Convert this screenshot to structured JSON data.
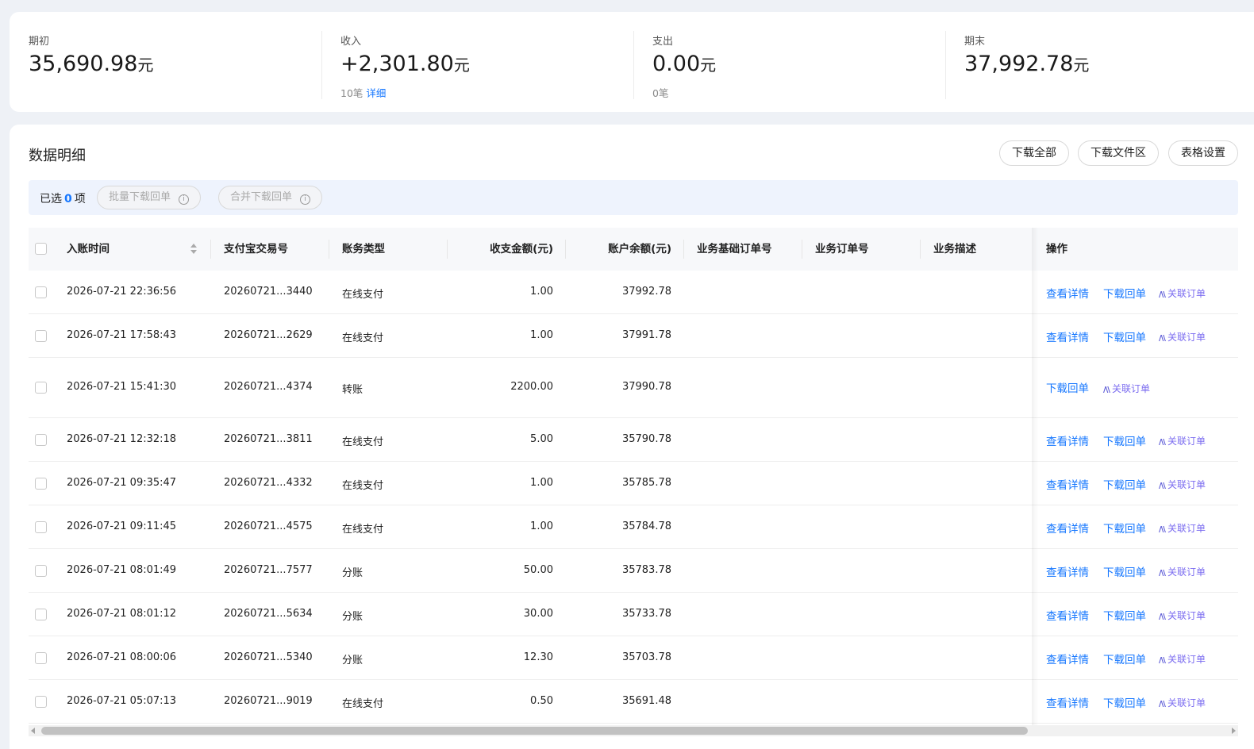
{
  "summary": [
    {
      "label": "期初",
      "value": "35,690.98",
      "unit": "元",
      "sub_count": "",
      "sub_link": ""
    },
    {
      "label": "收入",
      "value": "+2,301.80",
      "unit": "元",
      "sub_count": "10笔",
      "sub_link": "详细"
    },
    {
      "label": "支出",
      "value": "0.00",
      "unit": "元",
      "sub_count": "0笔",
      "sub_link": ""
    },
    {
      "label": "期末",
      "value": "37,992.78",
      "unit": "元",
      "sub_count": "",
      "sub_link": ""
    }
  ],
  "main": {
    "title": "数据明细",
    "buttons": {
      "download_all": "下载全部",
      "download_area": "下载文件区",
      "table_settings": "表格设置"
    }
  },
  "selection": {
    "prefix": "已选",
    "count": "0",
    "suffix": "项",
    "batch_download": "批量下载回单",
    "merge_download": "合并下载回单",
    "info_glyph": "i"
  },
  "table": {
    "headers": {
      "time": "入账时间",
      "trade_no": "支付宝交易号",
      "type": "账务类型",
      "amount": "收支金额(元)",
      "balance": "账户余额(元)",
      "base_order": "业务基础订单号",
      "order": "业务订单号",
      "desc": "业务描述",
      "ops": "操作"
    },
    "actions": {
      "detail": "查看详情",
      "receipt": "下载回单",
      "link_order": "关联订单",
      "ai_glyph": "/\\\\"
    },
    "rows": [
      {
        "time": "2026-07-21 22:36:56",
        "trade_no": "20260721...3440",
        "type": "在线支付",
        "amount": "1.00",
        "balance": "37992.78",
        "has_detail": true
      },
      {
        "time": "2026-07-21 17:58:43",
        "trade_no": "20260721...2629",
        "type": "在线支付",
        "amount": "1.00",
        "balance": "37991.78",
        "has_detail": true
      },
      {
        "time": "2026-07-21 15:41:30",
        "trade_no": "20260721...4374",
        "type": "转账",
        "amount": "2200.00",
        "balance": "37990.78",
        "has_detail": false
      },
      {
        "time": "2026-07-21 12:32:18",
        "trade_no": "20260721...3811",
        "type": "在线支付",
        "amount": "5.00",
        "balance": "35790.78",
        "has_detail": true
      },
      {
        "time": "2026-07-21 09:35:47",
        "trade_no": "20260721...4332",
        "type": "在线支付",
        "amount": "1.00",
        "balance": "35785.78",
        "has_detail": true
      },
      {
        "time": "2026-07-21 09:11:45",
        "trade_no": "20260721...4575",
        "type": "在线支付",
        "amount": "1.00",
        "balance": "35784.78",
        "has_detail": true
      },
      {
        "time": "2026-07-21 08:01:49",
        "trade_no": "20260721...7577",
        "type": "分账",
        "amount": "50.00",
        "balance": "35783.78",
        "has_detail": true
      },
      {
        "time": "2026-07-21 08:01:12",
        "trade_no": "20260721...5634",
        "type": "分账",
        "amount": "30.00",
        "balance": "35733.78",
        "has_detail": true
      },
      {
        "time": "2026-07-21 08:00:06",
        "trade_no": "20260721...5340",
        "type": "分账",
        "amount": "12.30",
        "balance": "35703.78",
        "has_detail": true
      },
      {
        "time": "2026-07-21 05:07:13",
        "trade_no": "20260721...9019",
        "type": "在线支付",
        "amount": "0.50",
        "balance": "35691.48",
        "has_detail": true
      }
    ]
  },
  "colors": {
    "accent": "#1677ff",
    "ai": "#7b6cf0"
  }
}
